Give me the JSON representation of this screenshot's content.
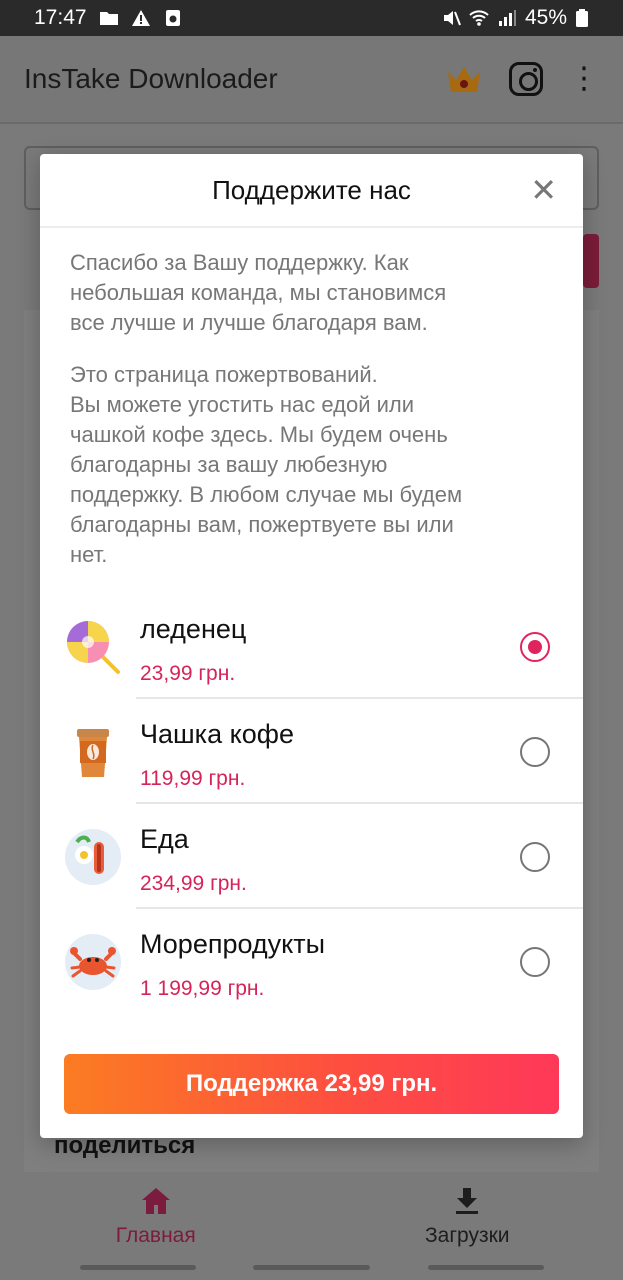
{
  "status_bar": {
    "time": "17:47",
    "battery": "45%"
  },
  "app_bar": {
    "title": "InsTake Downloader",
    "icons": [
      "crown-icon",
      "instagram-icon",
      "more-vert-icon"
    ]
  },
  "background": {
    "share_label": "поделиться"
  },
  "dialog": {
    "title": "Поддержите нас",
    "paragraph1": "Спасибо за Вашу поддержку. Как\nнебольшая команда, мы становимся\nвсе лучше и лучше благодаря вам.",
    "paragraph2": "Это страница пожертвований.\nВы можете угостить нас едой или\nчашкой кофе здесь. Мы будем очень\nблагодарны за вашу любезную\nподдержку. В любом случае мы будем\nблагодарны вам, пожертвуете вы или\nнет.",
    "options": [
      {
        "name": "леденец",
        "price": "23,99 грн.",
        "icon": "lollipop-icon",
        "selected": true
      },
      {
        "name": "Чашка кофе",
        "price": "119,99 грн.",
        "icon": "coffee-cup-icon",
        "selected": false
      },
      {
        "name": "Еда",
        "price": "234,99 грн.",
        "icon": "food-icon",
        "selected": false
      },
      {
        "name": "Морепродукты",
        "price": "1 199,99 грн.",
        "icon": "crab-icon",
        "selected": false
      }
    ],
    "button_label": "Поддержка 23,99 грн."
  },
  "bottom_nav": {
    "items": [
      {
        "label": "Главная",
        "icon": "home-icon",
        "active": true
      },
      {
        "label": "Загрузки",
        "icon": "download-icon",
        "active": false
      }
    ]
  },
  "colors": {
    "accent": "#e0245e",
    "price": "#d6245a",
    "button_start": "#fb7c22",
    "button_end": "#ff3859"
  }
}
